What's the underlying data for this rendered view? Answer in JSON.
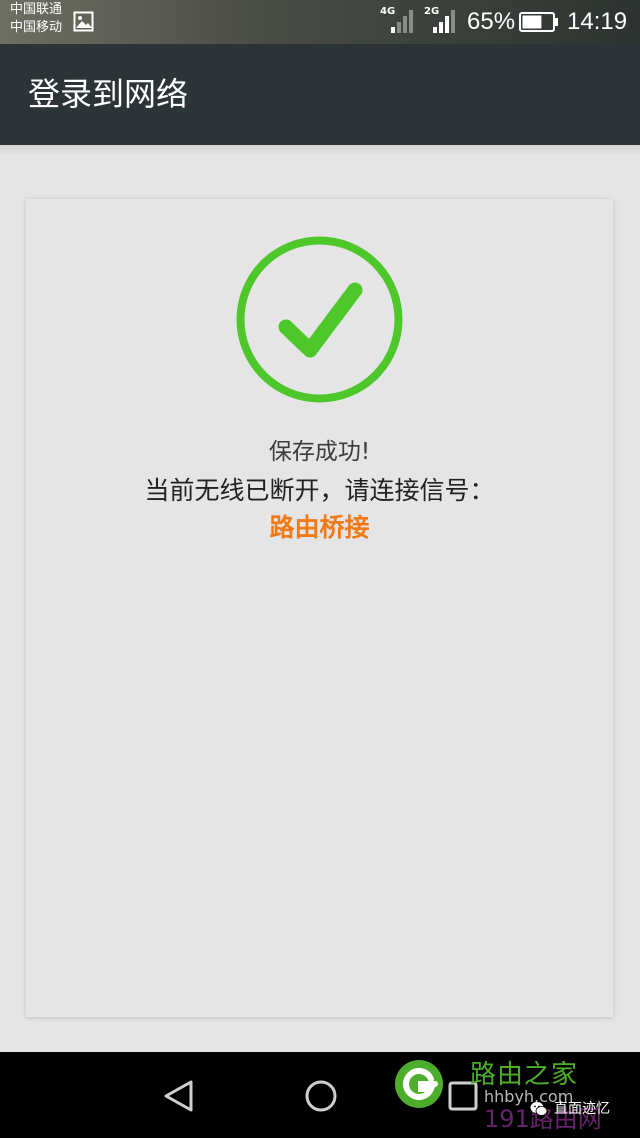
{
  "status_bar": {
    "carrier_1": "中国联通",
    "carrier_2": "中国移动",
    "network_1": "4G",
    "network_2": "2G",
    "battery_percent": "65%",
    "battery_level": 0.65,
    "time": "14:19"
  },
  "app_bar": {
    "title": "登录到网络"
  },
  "card": {
    "success_message": "保存成功!",
    "disconnect_message": "当前无线已断开，请连接信号：",
    "ssid": "路由桥接",
    "icon": "check-circle-icon",
    "accent_color": "#4ec72a",
    "ssid_color": "#f07a16"
  },
  "nav_bar": {
    "back_icon": "back-triangle-icon",
    "home_icon": "home-circle-icon",
    "recent_icon": "recent-square-icon"
  },
  "watermark": {
    "site_name": "路由之家",
    "site_url": "hhbyh.com",
    "site_191": "191路由网",
    "account_name": "直面迹忆"
  }
}
